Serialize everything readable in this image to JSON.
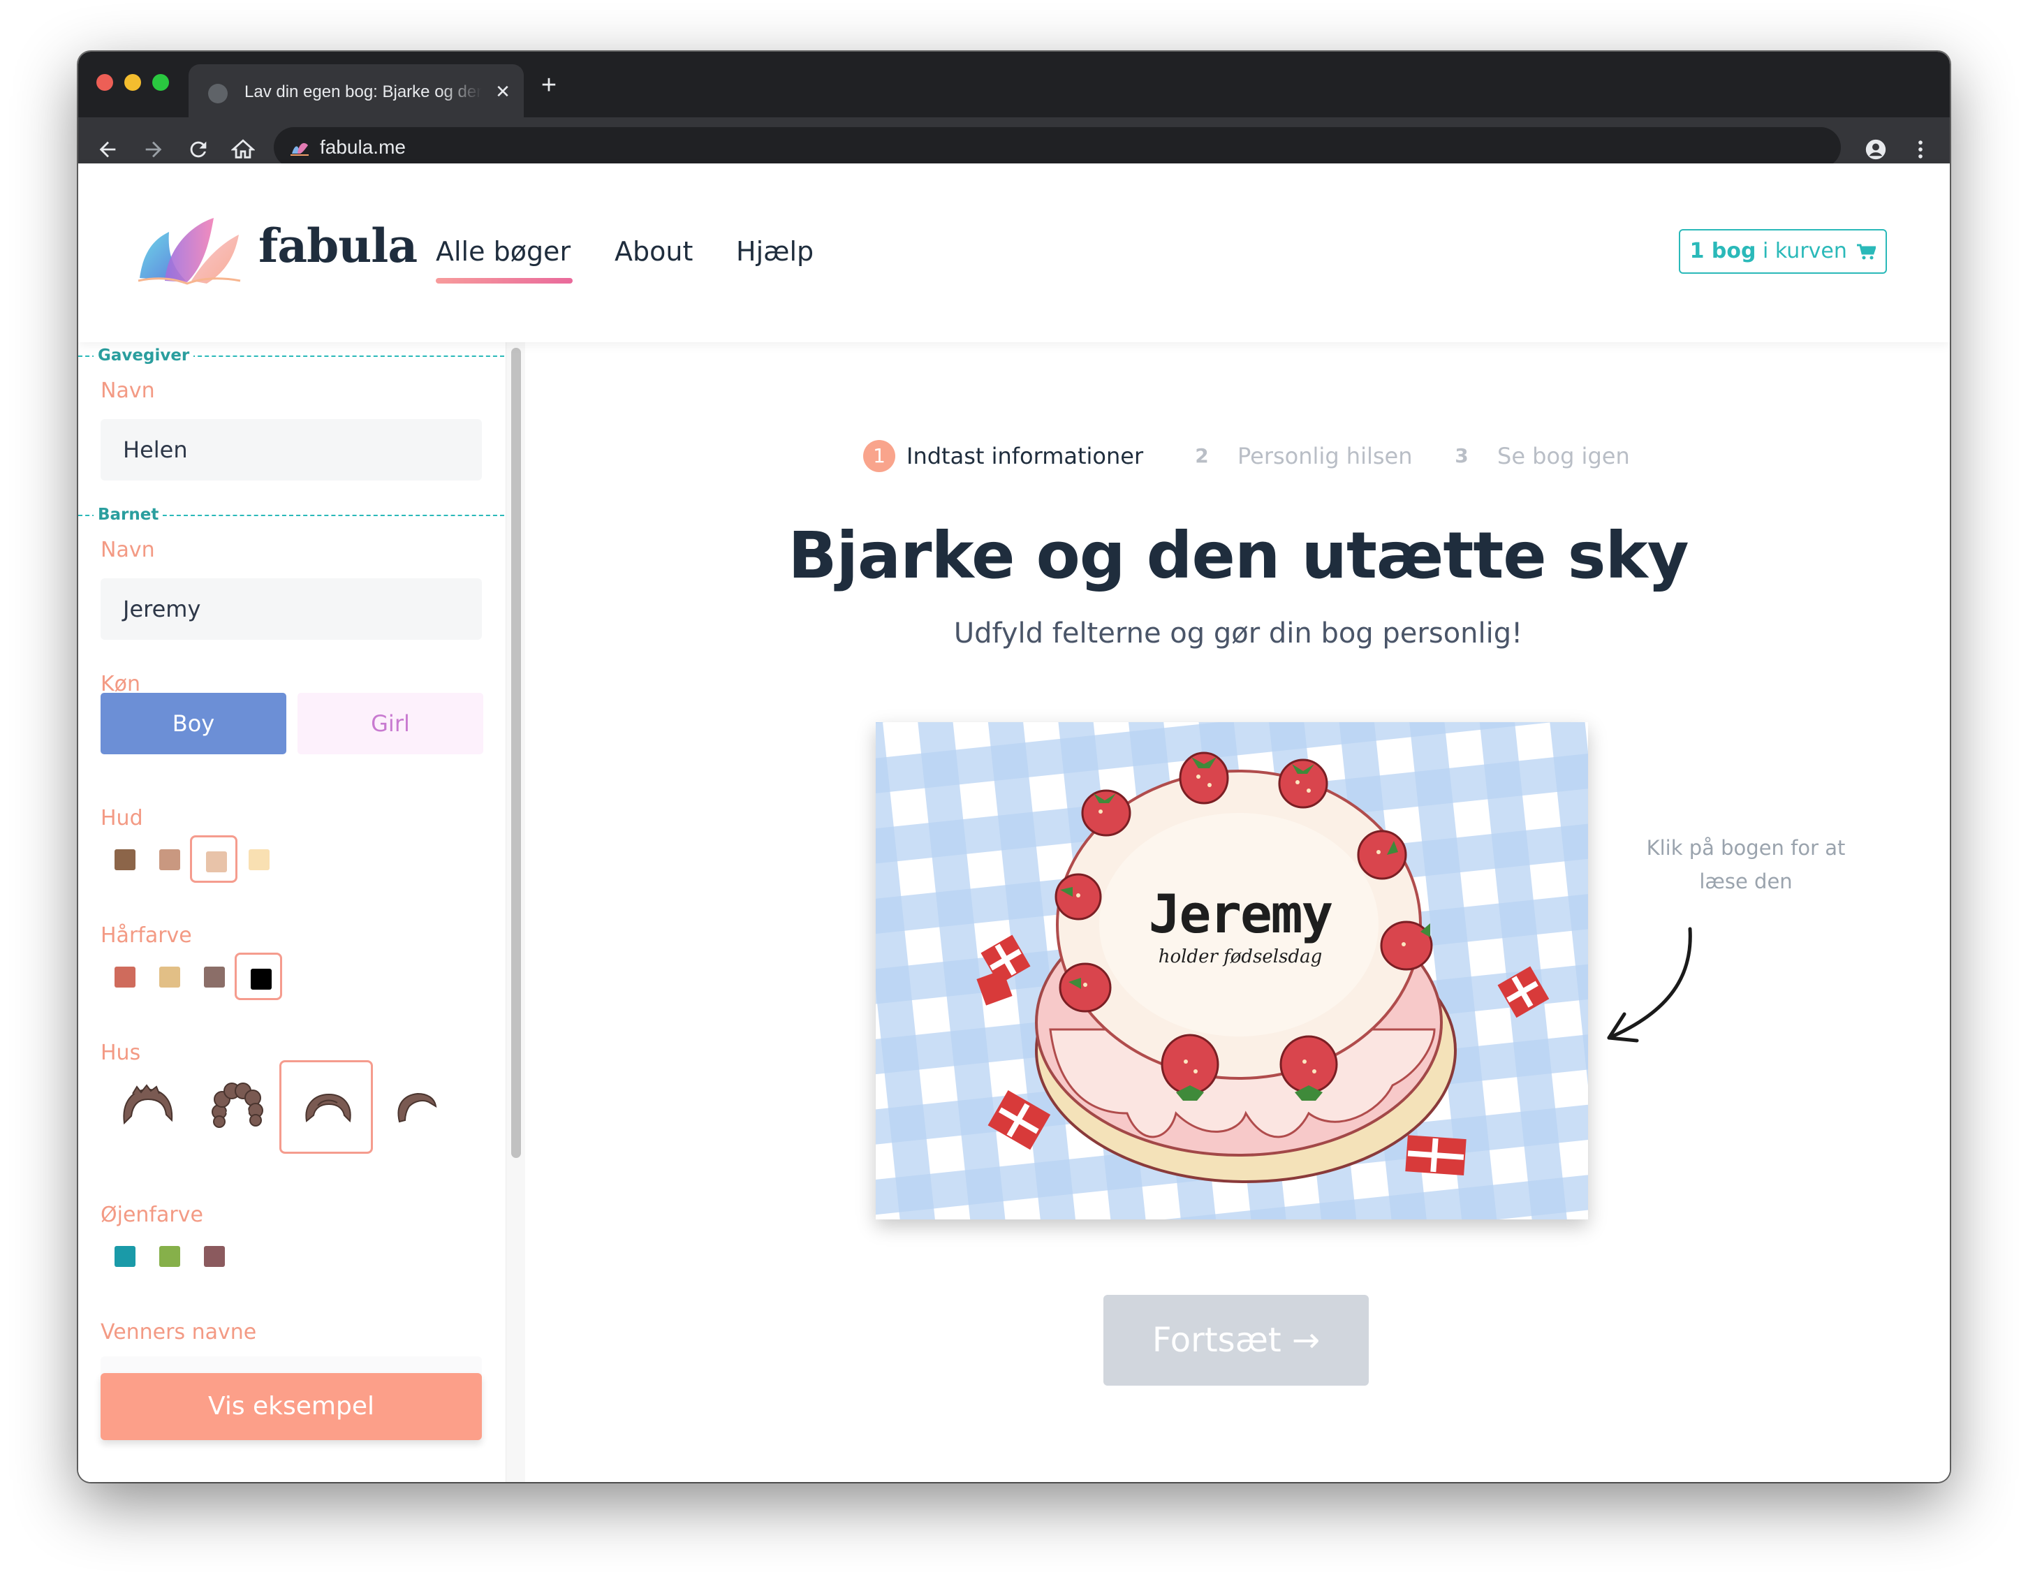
{
  "browser": {
    "tab_title": "Lav din egen bog: Bjarke og den utætte sky",
    "tab_close": "✕",
    "new_tab": "+",
    "url": "fabula.me",
    "icons": [
      "back-icon",
      "forward-icon",
      "reload-icon",
      "home-icon",
      "profile-icon",
      "menu-icon"
    ]
  },
  "header": {
    "logo_text": "fabula",
    "nav": [
      "Alle bøger",
      "About",
      "Hjælp"
    ],
    "active_nav": "Alle bøger",
    "cart": {
      "count": "1 bog",
      "suffix": " i kurven"
    }
  },
  "sidebar": {
    "giver_section": "Gavegiver",
    "giver_name_label": "Navn",
    "giver_name_value": "Helen",
    "child_section": "Barnet",
    "child_name_label": "Navn",
    "child_name_value": "Jeremy",
    "gender_label": "Køn",
    "gender_options": [
      "Boy",
      "Girl"
    ],
    "gender_selected": "Boy",
    "skin_label": "Hud",
    "skin_colors": [
      "#8c6549",
      "#c99880",
      "#e8c3a9",
      "#f9e0b2"
    ],
    "skin_selected": 2,
    "hair_color_label": "Hårfarve",
    "hair_colors": [
      "#cf6b5c",
      "#e2bf86",
      "#8b6e68",
      "#000000"
    ],
    "hair_color_selected": 3,
    "hair_style_label": "Hus",
    "hair_styles": [
      "hair-style-1",
      "hair-style-curly",
      "hair-style-short",
      "hair-style-side"
    ],
    "hair_style_selected": 2,
    "eye_color_label": "Øjenfarve",
    "eye_colors": [
      "#1a9aa8",
      "#86b04a",
      "#8b5a5e"
    ],
    "friends_label": "Venners navne",
    "preview_button": "Vis eksempel"
  },
  "main": {
    "steps": [
      {
        "num": "1",
        "label": "Indtast informationer",
        "active": true
      },
      {
        "num": "2",
        "label": "Personlig hilsen",
        "active": false
      },
      {
        "num": "3",
        "label": "Se bog igen",
        "active": false
      }
    ],
    "title": "Bjarke og den utætte sky",
    "subtitle": "Udfyld felterne og gør din bog personlig!",
    "cover_name": "Jeremy",
    "cover_subtitle": "holder fødselsdag",
    "hint_line1": "Klik på bogen for at",
    "hint_line2": "læse den",
    "continue_button": "Fortsæt →"
  },
  "colors": {
    "accent_teal": "#2ab9b9",
    "accent_coral": "#fc9f89",
    "boy_blue": "#6c8fd6",
    "label_coral": "#f39a84",
    "dark_text": "#1f2d3d"
  }
}
